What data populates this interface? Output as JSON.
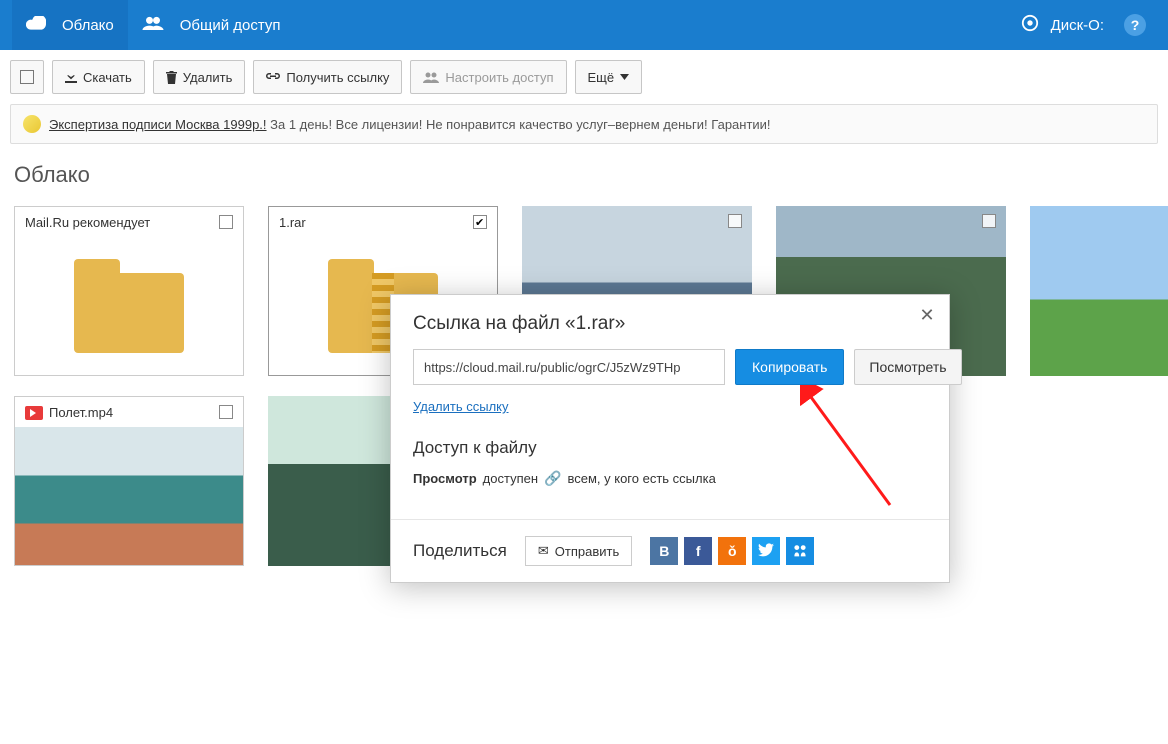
{
  "header": {
    "tab_cloud": "Облако",
    "tab_shared": "Общий доступ",
    "disk_o": "Диск-О:"
  },
  "toolbar": {
    "download": "Скачать",
    "delete": "Удалить",
    "get_link": "Получить ссылку",
    "configure_access": "Настроить доступ",
    "more": "Ещё"
  },
  "ad": {
    "link_text": "Экспертиза подписи Москва 1999р.!",
    "rest": " За 1 день! Все лицензии! Не понравится качество услуг–вернем деньги! Гарантии!"
  },
  "page_title": "Облако",
  "tiles": [
    {
      "name": "Mail.Ru рекомендует",
      "type": "folder",
      "checked": false
    },
    {
      "name": "1.rar",
      "type": "archive",
      "checked": true
    },
    {
      "name": "",
      "type": "photo",
      "class": "ph1",
      "checked": false
    },
    {
      "name": "",
      "type": "photo",
      "class": "ph2",
      "checked": false
    },
    {
      "name": "",
      "type": "photo",
      "class": "ph3",
      "checked": false
    },
    {
      "name": "Полет.mp4",
      "type": "video",
      "class": "ph4",
      "checked": false
    },
    {
      "name": "",
      "type": "photo",
      "class": "ph5",
      "checked": false
    }
  ],
  "modal": {
    "title_prefix": "Ссылка на файл «",
    "title_file": "1.rar",
    "title_suffix": "»",
    "url": "https://cloud.mail.ru/public/ogrC/J5zWz9THp",
    "copy": "Копировать",
    "view": "Посмотреть",
    "delete_link": "Удалить ссылку",
    "access_heading": "Доступ к файлу",
    "access_label": "Просмотр",
    "access_status": "доступен",
    "access_who": "всем, у кого есть ссылка",
    "share_heading": "Поделиться",
    "send": "Отправить"
  }
}
